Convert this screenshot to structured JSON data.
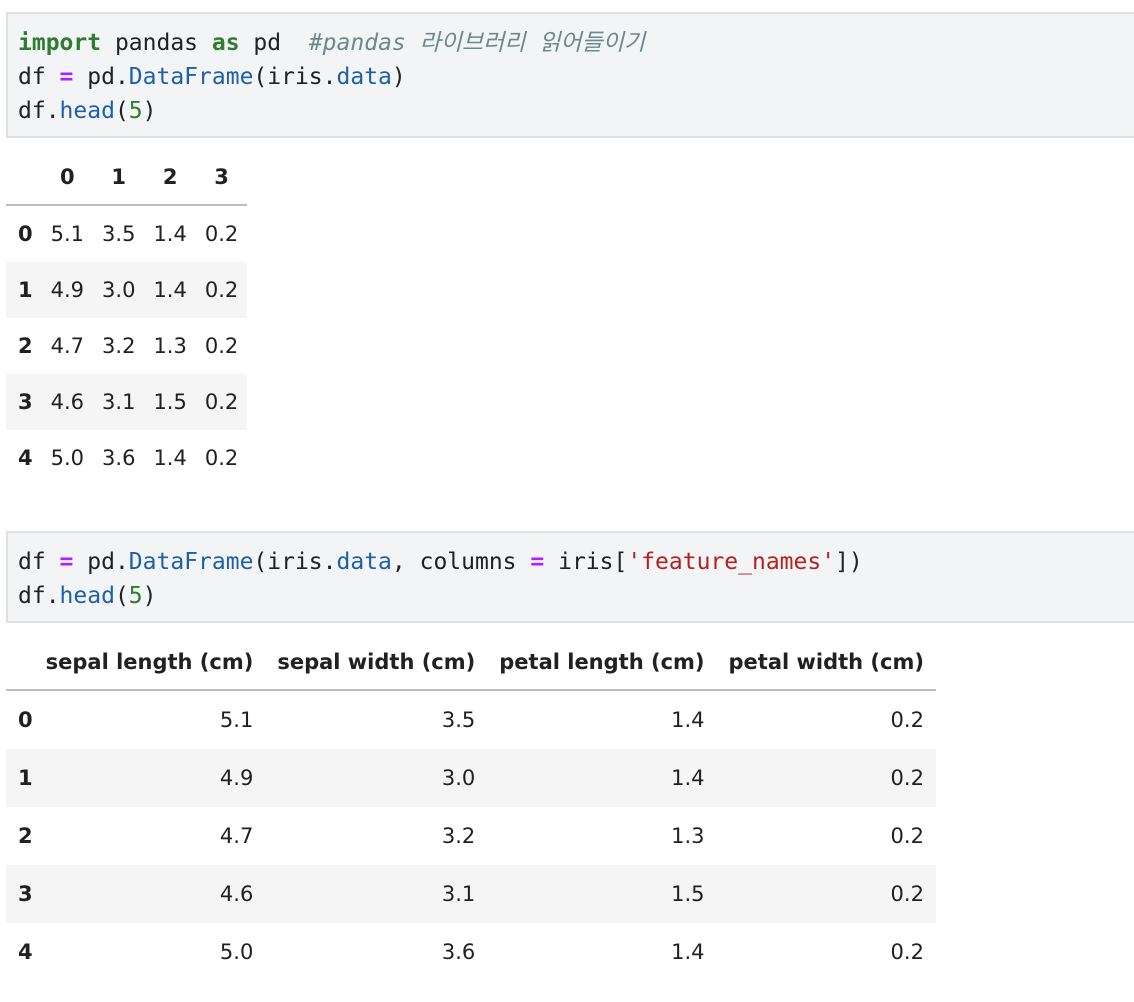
{
  "cell1": {
    "line1": {
      "kw_import": "import",
      "module": " pandas ",
      "kw_as": "as",
      "alias": " pd  ",
      "comment": "#pandas 라이브러리 읽어들이기"
    },
    "line2": {
      "var": "df ",
      "eq": "=",
      "pd": " pd.",
      "cls": "DataFrame",
      "open": "(iris.",
      "attr": "data",
      "close": ")"
    },
    "line3": {
      "obj": "df.",
      "method": "head",
      "open": "(",
      "arg": "5",
      "close": ")"
    }
  },
  "table1": {
    "columns": [
      "",
      "0",
      "1",
      "2",
      "3"
    ],
    "rows": [
      {
        "index": "0",
        "values": [
          "5.1",
          "3.5",
          "1.4",
          "0.2"
        ]
      },
      {
        "index": "1",
        "values": [
          "4.9",
          "3.0",
          "1.4",
          "0.2"
        ]
      },
      {
        "index": "2",
        "values": [
          "4.7",
          "3.2",
          "1.3",
          "0.2"
        ]
      },
      {
        "index": "3",
        "values": [
          "4.6",
          "3.1",
          "1.5",
          "0.2"
        ]
      },
      {
        "index": "4",
        "values": [
          "5.0",
          "3.6",
          "1.4",
          "0.2"
        ]
      }
    ]
  },
  "cell2": {
    "line1": {
      "var": "df ",
      "eq": "=",
      "pd": " pd.",
      "cls": "DataFrame",
      "open": "(iris.",
      "attr": "data",
      "mid": ", columns ",
      "eq2": "=",
      "iris": " iris[",
      "str": "'feature_names'",
      "close": "])"
    },
    "line2": {
      "obj": "df.",
      "method": "head",
      "open": "(",
      "arg": "5",
      "close": ")"
    }
  },
  "table2": {
    "columns": [
      "",
      "sepal length (cm)",
      "sepal width (cm)",
      "petal length (cm)",
      "petal width (cm)"
    ],
    "rows": [
      {
        "index": "0",
        "values": [
          "5.1",
          "3.5",
          "1.4",
          "0.2"
        ]
      },
      {
        "index": "1",
        "values": [
          "4.9",
          "3.0",
          "1.4",
          "0.2"
        ]
      },
      {
        "index": "2",
        "values": [
          "4.7",
          "3.2",
          "1.3",
          "0.2"
        ]
      },
      {
        "index": "3",
        "values": [
          "4.6",
          "3.1",
          "1.5",
          "0.2"
        ]
      },
      {
        "index": "4",
        "values": [
          "5.0",
          "3.6",
          "1.4",
          "0.2"
        ]
      }
    ]
  },
  "colors": {
    "keyword": "#2e7d32",
    "operator": "#aa22ff",
    "function": "#1f5fa8",
    "string": "#b22222",
    "comment": "#6a8a8a",
    "cell_bg": "#f3f4f5"
  }
}
